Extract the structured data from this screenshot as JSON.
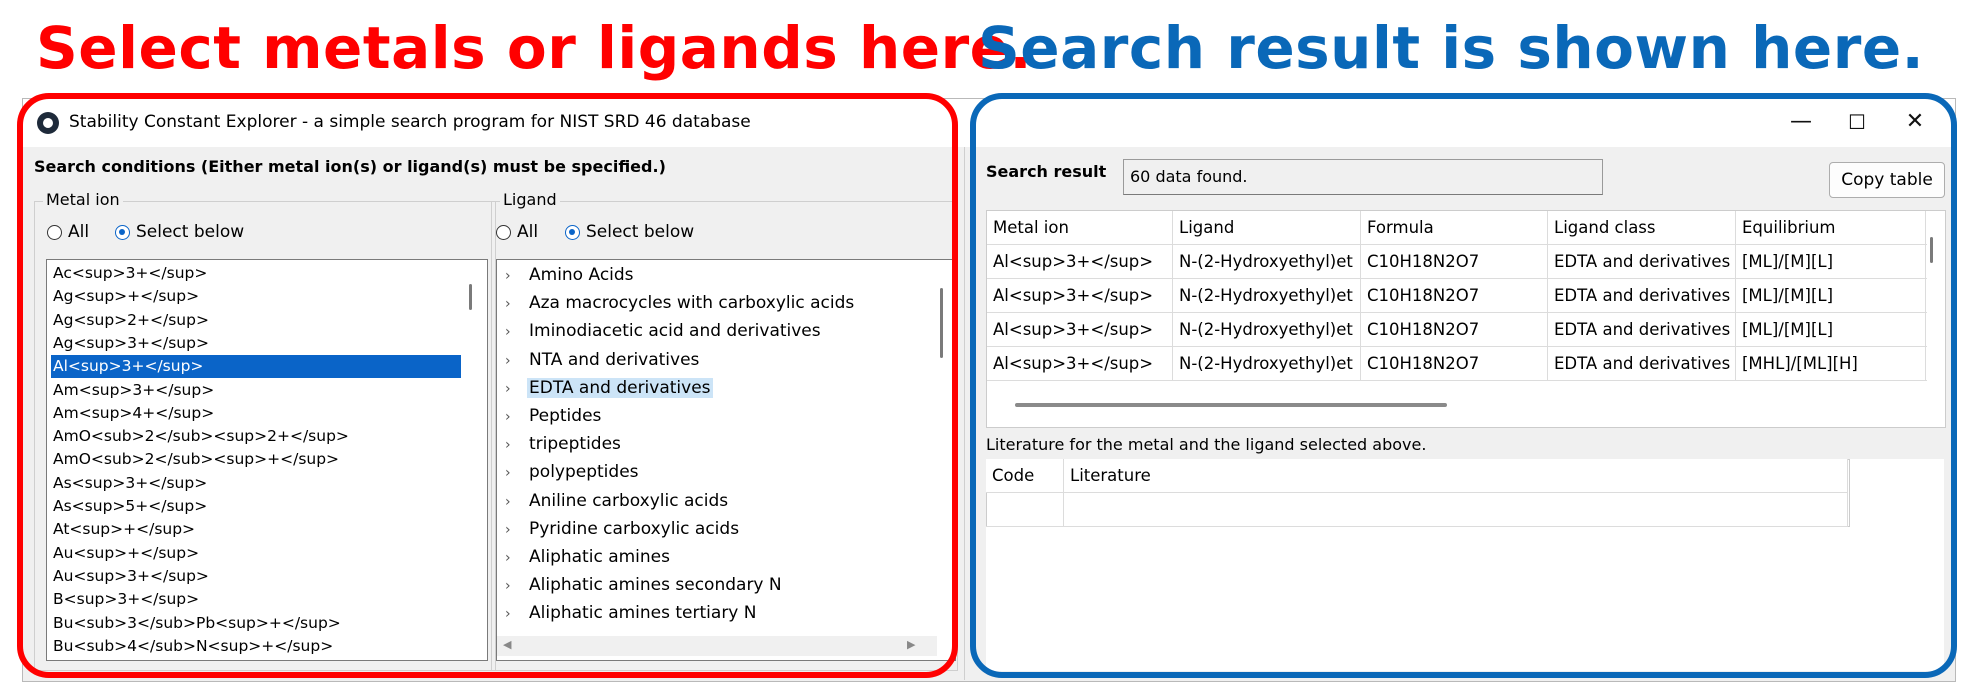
{
  "annotations": {
    "left": {
      "text": "Select metals or ligands here.",
      "color": "#ff0000"
    },
    "right": {
      "text": "Search result is shown here.",
      "color": "#0a68b8"
    }
  },
  "window": {
    "title": "Stability Constant Explorer - a simple search program for NIST SRD 46 database",
    "icon": "app-logo-icon",
    "controls": {
      "minimize": "—",
      "maximize": "☐",
      "close": "✕"
    }
  },
  "search_conditions": {
    "label": "Search conditions (Either metal ion(s) or ligand(s) must be specified.)",
    "metal": {
      "caption": "Metal ion",
      "radio_all": "All",
      "radio_select": "Select below",
      "selected_radio": "select",
      "items": [
        "Ac<sup>3+</sup>",
        "Ag<sup>+</sup>",
        "Ag<sup>2+</sup>",
        "Ag<sup>3+</sup>",
        "Al<sup>3+</sup>",
        "Am<sup>3+</sup>",
        "Am<sup>4+</sup>",
        "AmO<sub>2</sub><sup>2+</sup>",
        "AmO<sub>2</sub><sup>+</sup>",
        "As<sup>3+</sup>",
        "As<sup>5+</sup>",
        "At<sup>+</sup>",
        "Au<sup>+</sup>",
        "Au<sup>3+</sup>",
        "B<sup>3+</sup>",
        "Bu<sub>3</sub>Pb<sup>+</sup>",
        "Bu<sub>4</sub>N<sup>+</sup>"
      ],
      "selected_index": 4
    },
    "ligand": {
      "caption": "Ligand",
      "radio_all": "All",
      "radio_select": "Select below",
      "selected_radio": "select",
      "items": [
        "Amino Acids",
        "Aza macrocycles with carboxylic acids",
        "Iminodiacetic acid and derivatives",
        "NTA and derivatives",
        "EDTA and derivatives",
        "Peptides",
        "tripeptides",
        "polypeptides",
        "Aniline carboxylic acids",
        "Pyridine carboxylic acids",
        "Aliphatic amines",
        "Aliphatic amines secondary N",
        "Aliphatic amines tertiary N"
      ],
      "selected_index": 4
    }
  },
  "result": {
    "label": "Search result",
    "status": "60 data found.",
    "copy_button": "Copy table",
    "columns": [
      "Metal ion",
      "Ligand",
      "Formula",
      "Ligand class",
      "Equilibrium"
    ],
    "rows": [
      [
        "Al<sup>3+</sup>",
        "N-(2-Hydroxyethyl)et",
        "C10H18N2O7",
        "EDTA and derivatives",
        "[ML]/[M][L]"
      ],
      [
        "Al<sup>3+</sup>",
        "N-(2-Hydroxyethyl)et",
        "C10H18N2O7",
        "EDTA and derivatives",
        "[ML]/[M][L]"
      ],
      [
        "Al<sup>3+</sup>",
        "N-(2-Hydroxyethyl)et",
        "C10H18N2O7",
        "EDTA and derivatives",
        "[ML]/[M][L]"
      ],
      [
        "Al<sup>3+</sup>",
        "N-(2-Hydroxyethyl)et",
        "C10H18N2O7",
        "EDTA and derivatives",
        "[MHL]/[ML][H]"
      ]
    ]
  },
  "literature": {
    "label": "Literature for the metal and the ligand selected above.",
    "columns": [
      "Code",
      "Literature"
    ]
  }
}
